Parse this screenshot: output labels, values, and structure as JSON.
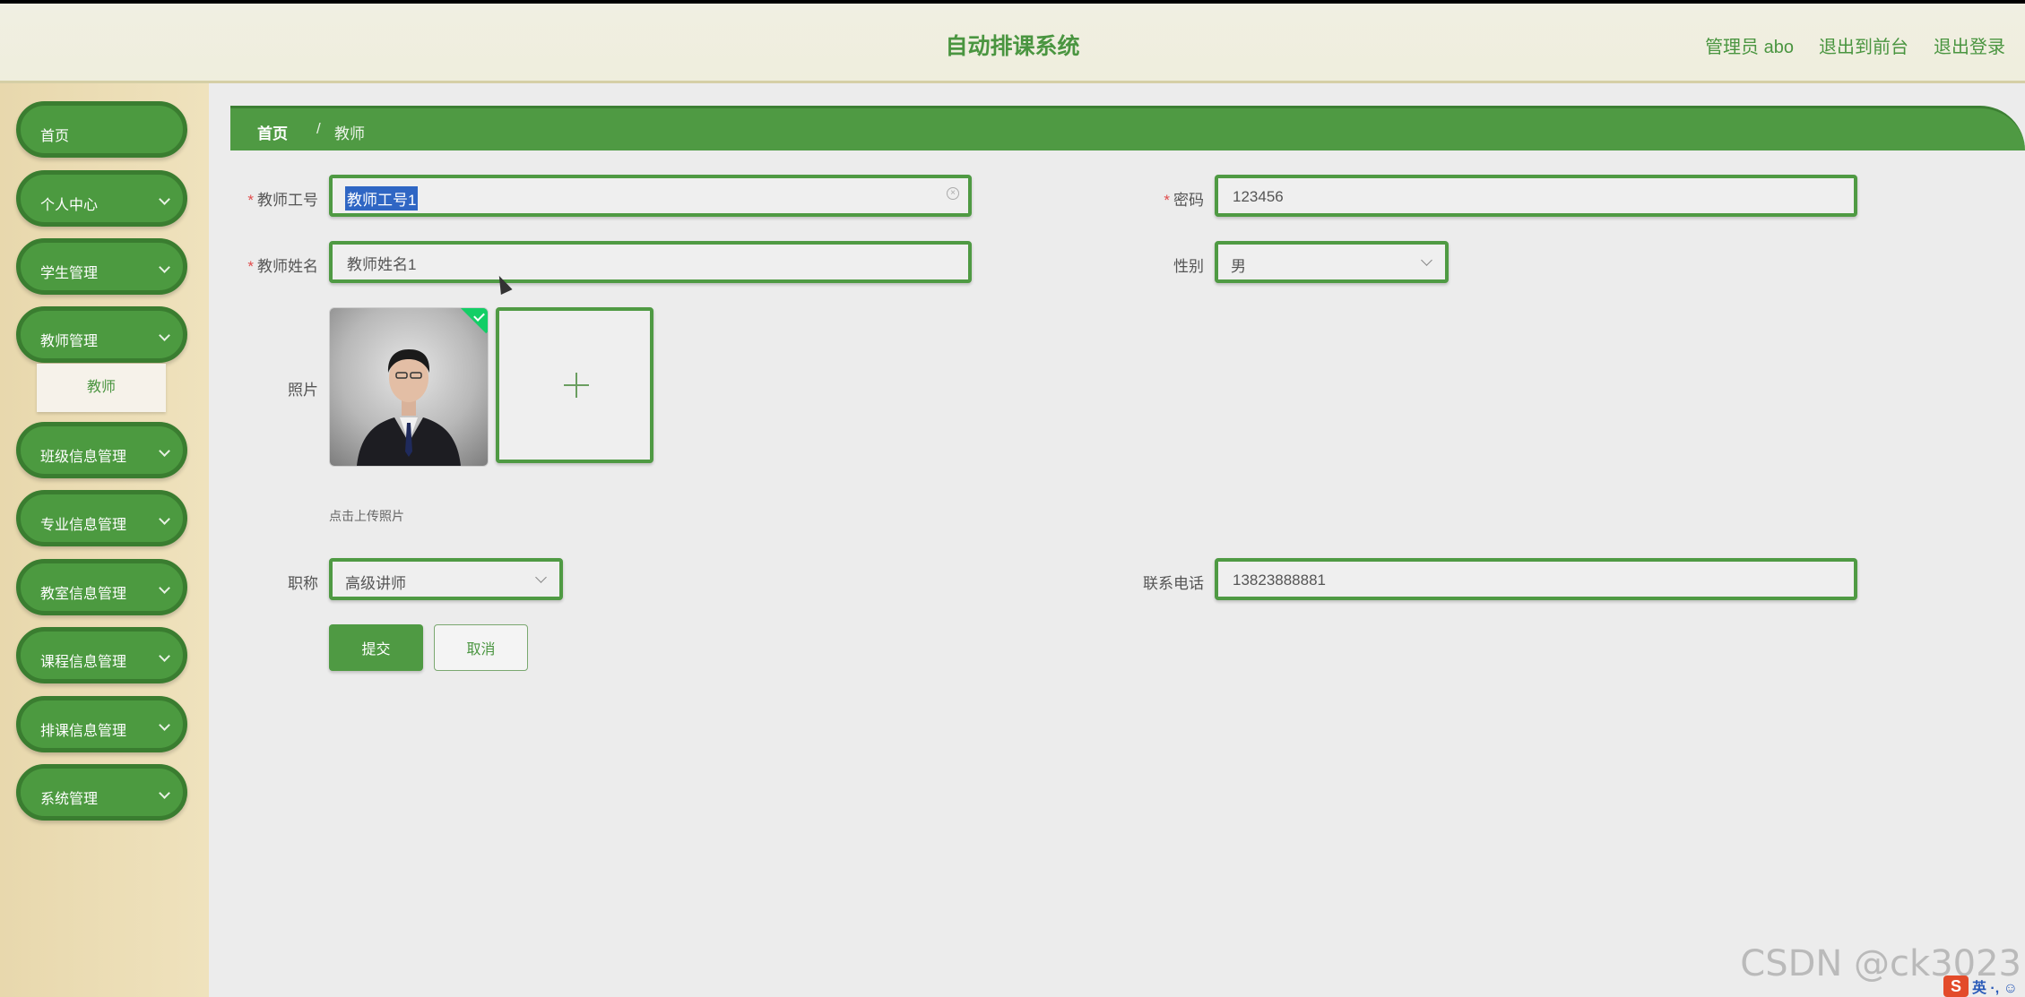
{
  "header": {
    "app_title": "自动排课系统",
    "links": [
      "管理员 abo",
      "退出到前台",
      "退出登录"
    ]
  },
  "sidebar": {
    "items": [
      {
        "label": "首页",
        "has_chevron": false
      },
      {
        "label": "个人中心",
        "has_chevron": true
      },
      {
        "label": "学生管理",
        "has_chevron": true
      },
      {
        "label": "教师管理",
        "has_chevron": true
      },
      {
        "label": "班级信息管理",
        "has_chevron": true
      },
      {
        "label": "专业信息管理",
        "has_chevron": true
      },
      {
        "label": "教室信息管理",
        "has_chevron": true
      },
      {
        "label": "课程信息管理",
        "has_chevron": true
      },
      {
        "label": "排课信息管理",
        "has_chevron": true
      },
      {
        "label": "系统管理",
        "has_chevron": true
      }
    ],
    "submenu_label": "教师"
  },
  "breadcrumb": {
    "home": "首页",
    "separator": "/",
    "current": "教师"
  },
  "form": {
    "teacher_id": {
      "label": "教师工号",
      "value": "教师工号1",
      "required": true
    },
    "password": {
      "label": "密码",
      "value": "123456",
      "required": true
    },
    "teacher_name": {
      "label": "教师姓名",
      "value": "教师姓名1",
      "required": true
    },
    "gender": {
      "label": "性别",
      "value": "男"
    },
    "photo": {
      "label": "照片",
      "hint": "点击上传照片"
    },
    "title": {
      "label": "职称",
      "value": "高级讲师"
    },
    "phone": {
      "label": "联系电话",
      "value": "13823888881"
    },
    "submit_label": "提交",
    "cancel_label": "取消"
  },
  "overlay": {
    "watermark": "CSDN @ck3023",
    "ime_logo": "S",
    "ime_text": "英 ·, ☺"
  },
  "colors": {
    "brand_green": "#4f9a43",
    "required_red": "#e04c4c",
    "selection_blue": "#2f66c4"
  }
}
